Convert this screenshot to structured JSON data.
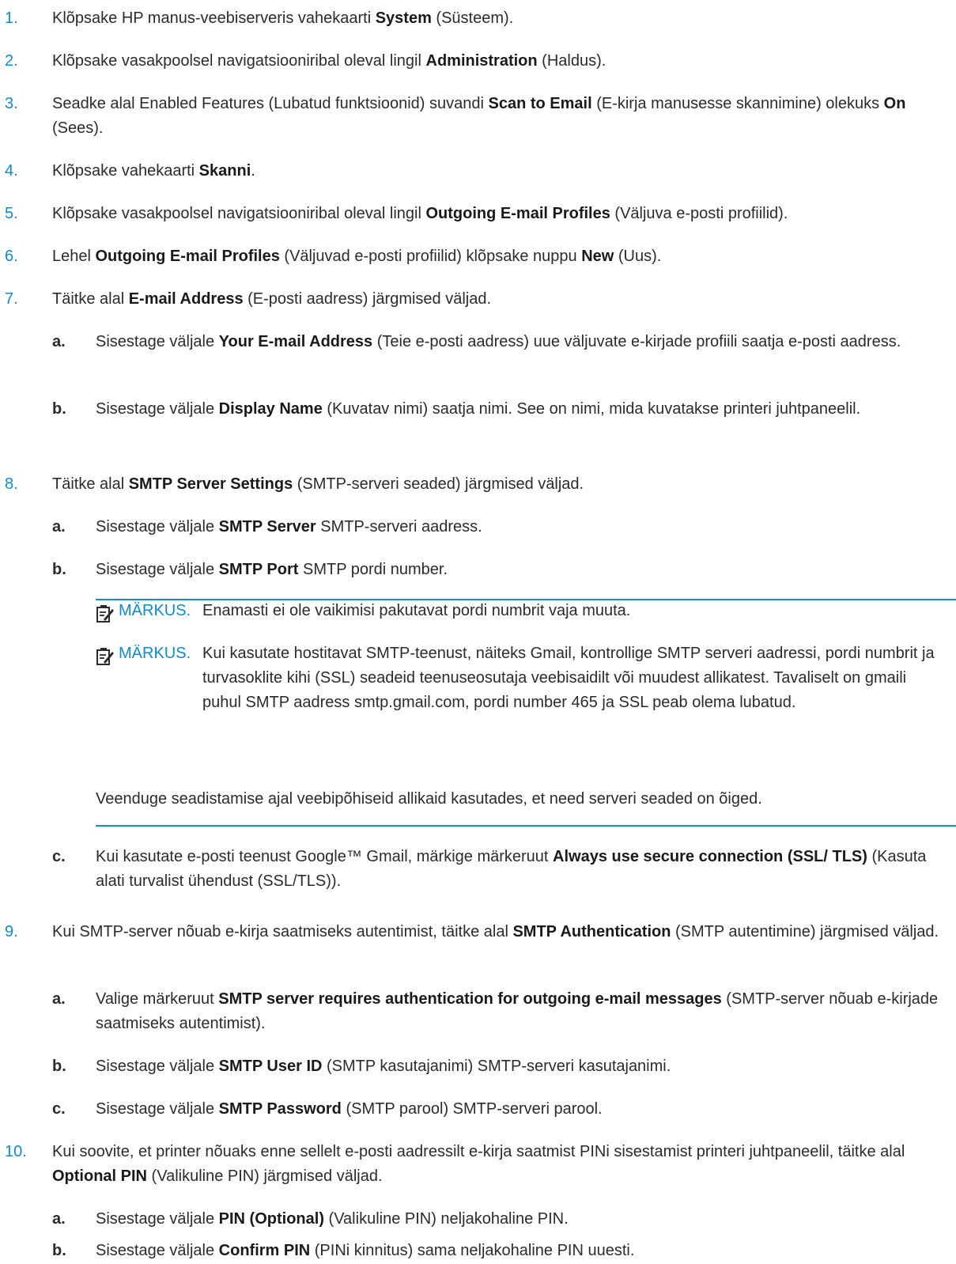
{
  "steps": [
    {
      "num": "1.",
      "parts": [
        "Klõpsake HP manus-veebiserveris vahekaarti ",
        "System",
        " (Süsteem)."
      ]
    },
    {
      "num": "2.",
      "parts": [
        "Klõpsake vasakpoolsel navigatsiooniribal oleval lingil ",
        "Administration",
        " (Haldus)."
      ]
    },
    {
      "num": "3.",
      "parts": [
        "Seadke alal Enabled Features (Lubatud funktsioonid) suvandi ",
        "Scan to Email",
        " (E-kirja manusesse skannimine) olekuks ",
        "On",
        " (Sees)."
      ]
    },
    {
      "num": "4.",
      "parts": [
        "Klõpsake vahekaarti ",
        "Skanni",
        "."
      ]
    },
    {
      "num": "5.",
      "parts": [
        "Klõpsake vasakpoolsel navigatsiooniribal oleval lingil ",
        "Outgoing E-mail Profiles",
        " (Väljuva e-posti profiilid)."
      ]
    },
    {
      "num": "6.",
      "parts": [
        "Lehel ",
        "Outgoing E-mail Profiles",
        " (Väljuvad e-posti profiilid) klõpsake nuppu ",
        "New",
        " (Uus)."
      ]
    },
    {
      "num": "7.",
      "parts": [
        "Täitke alal ",
        "E-mail Address",
        " (E-posti aadress) järgmised väljad."
      ]
    },
    {
      "num": "a.",
      "parts": [
        "Sisestage väljale ",
        "Your E-mail Address",
        " (Teie e-posti aadress) uue väljuvate e-kirjade profiili saatja e-posti aadress."
      ]
    },
    {
      "num": "b.",
      "parts": [
        "Sisestage väljale ",
        "Display Name",
        " (Kuvatav nimi) saatja nimi. See on nimi, mida kuvatakse printeri juhtpaneelil."
      ]
    },
    {
      "num": "8.",
      "parts": [
        "Täitke alal ",
        "SMTP Server Settings",
        " (SMTP-serveri seaded) järgmised väljad."
      ]
    },
    {
      "num": "a.",
      "parts": [
        "Sisestage väljale ",
        "SMTP Server",
        " SMTP-serveri aadress."
      ]
    },
    {
      "num": "b.",
      "parts": [
        "Sisestage väljale ",
        "SMTP Port",
        " SMTP pordi number."
      ]
    },
    {
      "num": "c.",
      "parts": [
        "Kui kasutate e-posti teenust Google™ Gmail, märkige märkeruut ",
        "Always use secure connection (SSL/ TLS)",
        " (Kasuta alati turvalist ühendust (SSL/TLS))."
      ]
    },
    {
      "num": "9.",
      "parts": [
        "Kui SMTP-server nõuab e-kirja saatmiseks autentimist, täitke alal ",
        "SMTP Authentication",
        " (SMTP autentimine) järgmised väljad."
      ]
    },
    {
      "num": "a.",
      "parts": [
        "Valige märkeruut ",
        "SMTP server requires authentication for outgoing e-mail messages",
        " (SMTP-server nõuab e-kirjade saatmiseks autentimist)."
      ]
    },
    {
      "num": "b.",
      "parts": [
        "Sisestage väljale ",
        "SMTP User ID",
        " (SMTP kasutajanimi) SMTP-serveri kasutajanimi."
      ]
    },
    {
      "num": "c.",
      "parts": [
        "Sisestage väljale ",
        "SMTP Password",
        " (SMTP parool) SMTP-serveri parool."
      ]
    },
    {
      "num": "10.",
      "parts": [
        "Kui soovite, et printer nõuaks enne sellelt e-posti aadressilt e-kirja saatmist PINi sisestamist printeri juhtpaneelil, täitke alal ",
        "Optional PIN",
        " (Valikuline PIN) järgmised väljad."
      ]
    },
    {
      "num": "a.",
      "parts": [
        "Sisestage väljale ",
        "PIN (Optional)",
        " (Valikuline PIN) neljakohaline PIN."
      ]
    },
    {
      "num": "b.",
      "parts": [
        "Sisestage väljale ",
        "Confirm PIN",
        " (PINi kinnitus) sama neljakohaline PIN uuesti."
      ]
    }
  ],
  "notes": [
    {
      "label": "MÄRKUS.",
      "text": "Enamasti ei ole vaikimisi pakutavat pordi numbrit vaja muuta."
    },
    {
      "label": "MÄRKUS.",
      "text": "Kui kasutate hostitavat SMTP-teenust, näiteks Gmail, kontrollige SMTP serveri aadressi, pordi numbrit ja turvasoklite kihi (SSL) seadeid teenuseosutaja veebisaidilt või muudest allikatest. Tavaliselt on gmaili puhul SMTP aadress smtp.gmail.com, pordi number 465 ja SSL peab olema lubatud.",
      "follow": "Veenduge seadistamise ajal veebipõhiseid allikaid kasutades, et need serveri seaded on õiged."
    }
  ]
}
